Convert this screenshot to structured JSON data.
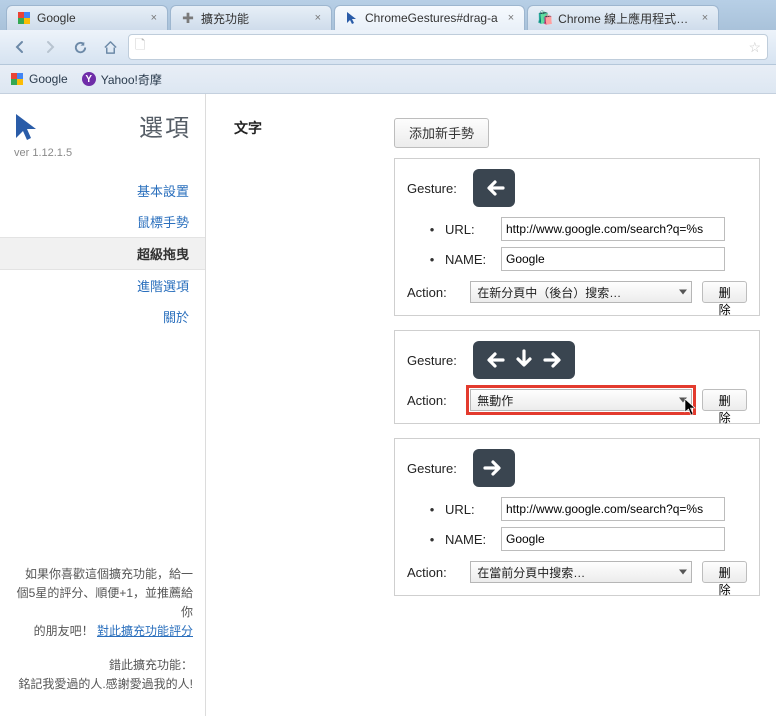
{
  "tabs": [
    {
      "title": "Google",
      "icon": "google"
    },
    {
      "title": "擴充功能",
      "icon": "puzzle"
    },
    {
      "title": "ChromeGestures#drag-a",
      "icon": "cursor",
      "active": true
    },
    {
      "title": "Chrome 線上應用程式商店",
      "icon": "store"
    }
  ],
  "omnibox": {
    "value": ""
  },
  "bookmarks": [
    {
      "label": "Google",
      "icon": "google"
    },
    {
      "label": "Yahoo!奇摩",
      "icon": "yahoo"
    }
  ],
  "sidebar": {
    "title": "選項",
    "version": "ver 1.12.1.5",
    "nav_basic": "基本設置",
    "nav_mouse": "鼠標手勢",
    "nav_drag": "超級拖曳",
    "nav_adv": "進階選項",
    "nav_about": "關於",
    "promo_line1": "如果你喜歡這個擴充功能，給一",
    "promo_line2": "個5星的評分、順便+1，並推薦給你",
    "promo_line3": "的朋友吧！",
    "promo_link": "對此擴充功能評分",
    "credit_line1": "錯此擴充功能：",
    "credit_line2": "銘記我愛過的人.感謝愛過我的人!"
  },
  "section": {
    "heading": "文字",
    "add_label": "添加新手勢"
  },
  "labels": {
    "gesture": "Gesture:",
    "url": "URL:",
    "name": "NAME:",
    "action": "Action:",
    "delete": "删除"
  },
  "cards": [
    {
      "gesture": [
        "left"
      ],
      "fields": {
        "url": "http://www.google.com/search?q=%s",
        "name": "Google"
      },
      "action": "在新分頁中（後台）搜索…",
      "highlight": false
    },
    {
      "gesture": [
        "left",
        "down",
        "right"
      ],
      "fields": null,
      "action": "無動作",
      "highlight": true
    },
    {
      "gesture": [
        "right"
      ],
      "fields": {
        "url": "http://www.google.com/search?q=%s",
        "name": "Google"
      },
      "action": "在當前分頁中搜索…",
      "highlight": false
    }
  ]
}
